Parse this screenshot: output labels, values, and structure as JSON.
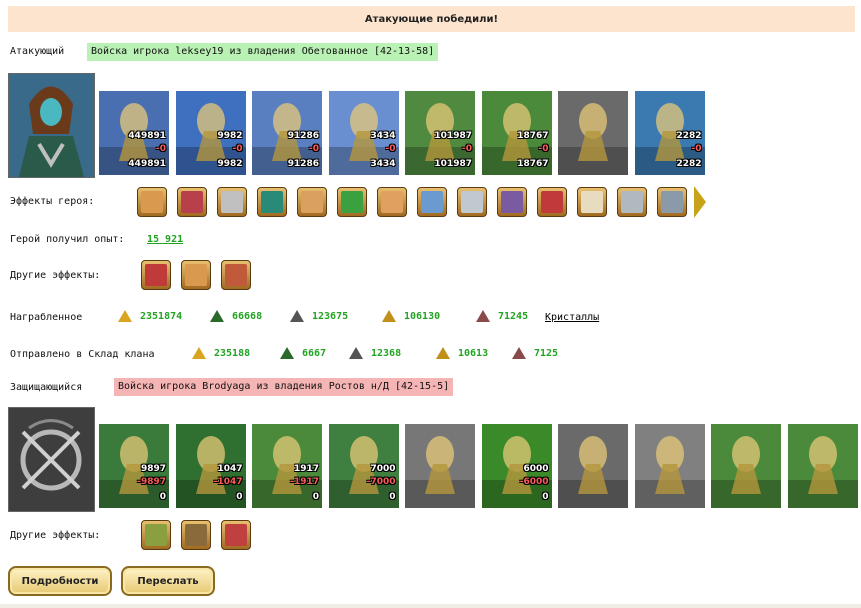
{
  "banner": "Атакующие победили!",
  "attacker": {
    "label": "Атакующий",
    "army": "Войска игрока leksey19 из владения Обетованное [42-13-58]",
    "units": [
      {
        "n": "449891",
        "d": "-0",
        "r": "449891",
        "color": "#4a6fb0"
      },
      {
        "n": "9982",
        "d": "-0",
        "r": "9982",
        "color": "#3f6fbf"
      },
      {
        "n": "91286",
        "d": "-0",
        "r": "91286",
        "color": "#5a7fc0"
      },
      {
        "n": "3434",
        "d": "-0",
        "r": "3434",
        "color": "#6a8fd0"
      },
      {
        "n": "101987",
        "d": "-0",
        "r": "101987",
        "color": "#4f8a40"
      },
      {
        "n": "18767",
        "d": "-0",
        "r": "18767",
        "color": "#4a8a3a"
      },
      {
        "n": "",
        "d": "",
        "r": "",
        "color": "#6a6a6a"
      },
      {
        "n": "2282",
        "d": "-0",
        "r": "2282",
        "color": "#3a7ab0"
      }
    ]
  },
  "hero_effects": {
    "label": "Эффекты героя:"
  },
  "experience": {
    "label": "Герой получил опыт:",
    "value": "15 921"
  },
  "other_effects_1": {
    "label": "Другие эффекты:"
  },
  "loot": {
    "label": "Награбленное",
    "values": [
      "2351874",
      "66668",
      "123675",
      "106130",
      "71245"
    ],
    "link": "Кристаллы"
  },
  "clan": {
    "label": "Отправлено в Склад клана",
    "values": [
      "235188",
      "6667",
      "12368",
      "10613",
      "7125"
    ]
  },
  "defender": {
    "label": "Защищающийся",
    "army": "Войска игрока Brodyaga из владения Ростов н/Д [42-15-5]",
    "units": [
      {
        "n": "9897",
        "d": "-9897",
        "r": "0",
        "color": "#3a7a3a"
      },
      {
        "n": "1047",
        "d": "-1047",
        "r": "0",
        "color": "#2f6f2f"
      },
      {
        "n": "1917",
        "d": "-1917",
        "r": "0",
        "color": "#4a8a3a"
      },
      {
        "n": "7000",
        "d": "-7000",
        "r": "0",
        "color": "#3f7f3f"
      },
      {
        "n": "",
        "d": "",
        "r": "",
        "color": "#777777"
      },
      {
        "n": "6000",
        "d": "-6000",
        "r": "0",
        "color": "#3a8a2a"
      },
      {
        "n": "",
        "d": "",
        "r": "",
        "color": "#6a6a6a"
      },
      {
        "n": "",
        "d": "",
        "r": "",
        "color": "#808080"
      },
      {
        "n": "",
        "d": "",
        "r": "",
        "color": "#4a8a3a"
      },
      {
        "n": "",
        "d": "",
        "r": "",
        "color": "#4a8a3a"
      }
    ]
  },
  "other_effects_2": {
    "label": "Другие эффекты:"
  },
  "buttons": {
    "details": "Подробности",
    "forward": "Переслать"
  },
  "colors": {
    "green": "#22a322",
    "attacker_bg": "#b9f2b4",
    "defender_bg": "#f6b5b5",
    "banner_bg": "#fde4cf"
  }
}
